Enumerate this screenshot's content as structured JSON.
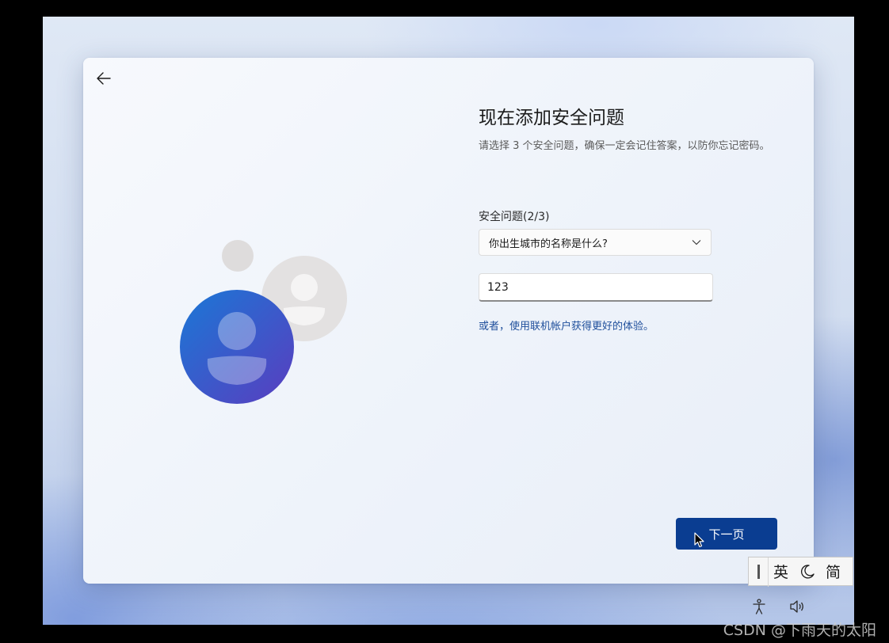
{
  "page": {
    "title": "现在添加安全问题",
    "subtitle": "请选择 3 个安全问题，确保一定会记住答案，以防你忘记密码。"
  },
  "form": {
    "question_label": "安全问题(2/3)",
    "selected_question": "你出生城市的名称是什么?",
    "answer_value": "123",
    "alt_link": "或者，使用联机帐户获得更好的体验。"
  },
  "footer": {
    "next_label": "下一页"
  },
  "ime": {
    "mode": "英",
    "moon_glyph": "☽",
    "script": "简"
  },
  "watermark": "CSDN @下雨天的太阳",
  "icons": {
    "back": "arrow-left-icon",
    "chevron": "chevron-down-icon",
    "accessibility": "accessibility-icon",
    "volume": "volume-icon"
  },
  "colors": {
    "accent": "#0a3d91",
    "link": "#1f4f9c"
  }
}
